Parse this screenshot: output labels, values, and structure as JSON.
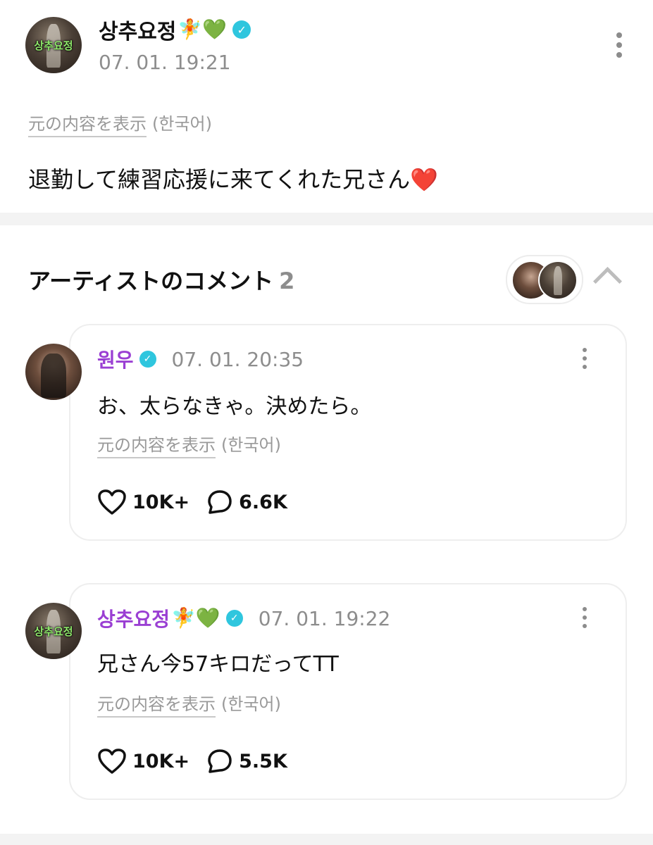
{
  "post": {
    "author": "상추요정",
    "author_emoji": "🧚💚",
    "timestamp": "07. 01. 19:21",
    "translate_link": "元の内容を表示",
    "translate_lang": "(한국어)",
    "body": "退勤して練習応援に来てくれた兄さん❤️",
    "avatar_text": "상추요정"
  },
  "artist_comments": {
    "title": "アーティストのコメント",
    "count": "2"
  },
  "comments": [
    {
      "author": "원우",
      "author_emoji": "",
      "timestamp": "07. 01. 20:35",
      "text": "お、太らなきゃ。決めたら。",
      "translate_link": "元の内容を表示",
      "translate_lang": "(한국어)",
      "likes": "10K+",
      "replies": "6.6K"
    },
    {
      "author": "상추요정",
      "author_emoji": "🧚💚",
      "timestamp": "07. 01. 19:22",
      "text": "兄さん今57キロだってTT",
      "translate_link": "元の内容を表示",
      "translate_lang": "(한국어)",
      "likes": "10K+",
      "replies": "5.5K",
      "avatar_text": "상추요정"
    }
  ],
  "colors": {
    "verified": "#2fc6de",
    "artist_name": "#9a3fd3",
    "muted_text": "#8d8d8d"
  },
  "icons": [
    "verified-icon",
    "more-vertical-icon",
    "chevron-up-icon",
    "heart-icon",
    "comment-bubble-icon"
  ]
}
